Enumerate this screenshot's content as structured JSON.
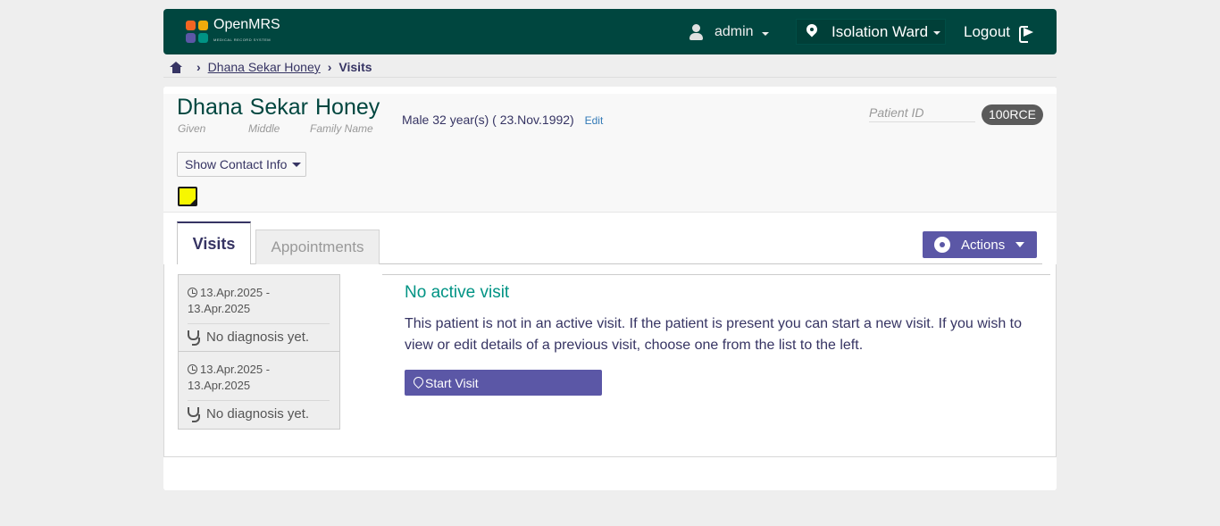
{
  "header": {
    "logo_text": "OpenMRS",
    "logo_sub": "MEDICAL RECORD SYSTEM",
    "user": "admin",
    "location": "Isolation Ward",
    "logout": "Logout"
  },
  "breadcrumb": {
    "patient": "Dhana Sekar Honey",
    "current": "Visits"
  },
  "patient": {
    "given": "Dhana",
    "middle": "Sekar",
    "family": "Honey",
    "given_label": "Given",
    "middle_label": "Middle",
    "family_label": "Family Name",
    "demographics": "Male  32 year(s) ( 23.Nov.1992)",
    "edit": "Edit",
    "id_label": "Patient ID",
    "id_value": "100RCE",
    "contact_btn": "Show Contact Info"
  },
  "tabs": {
    "visits": "Visits",
    "appointments": "Appointments",
    "actions": "Actions"
  },
  "visits": [
    {
      "dates": "13.Apr.2025 -",
      "dates2": "13.Apr.2025",
      "diagnosis": "No diagnosis yet."
    },
    {
      "dates": "13.Apr.2025 -",
      "dates2": "13.Apr.2025",
      "diagnosis": "No diagnosis yet."
    }
  ],
  "no_visit": {
    "title": "No active visit",
    "text": "This patient is not in an active visit. If the patient is present you can start a new visit. If you wish to view or edit details of a previous visit, choose one from the list to the left.",
    "start_btn": "Start Visit"
  },
  "colors": {
    "header_bg": "#00463f",
    "accent": "#5b57a6",
    "teal": "#009384"
  }
}
